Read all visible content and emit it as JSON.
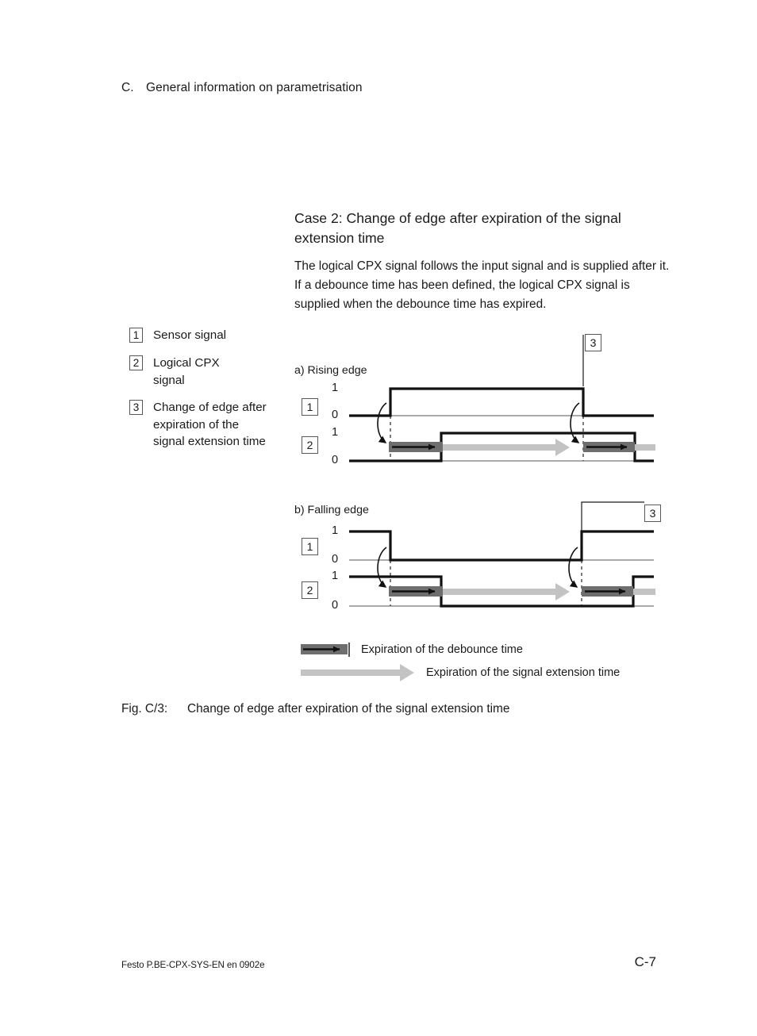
{
  "running_head": {
    "label": "C.",
    "title": "General information on parametrisation"
  },
  "case": {
    "heading": "Case 2: Change of edge after expiration of the signal extension time",
    "body": "The logical CPX signal follows the input signal and is supplied after it. If a debounce time has been defined, the logical CPX signal is supplied when the debounce time has expired."
  },
  "legend": {
    "items": [
      {
        "num": "1",
        "text": "Sensor signal"
      },
      {
        "num": "2",
        "text": "Logical CPX signal"
      },
      {
        "num": "3",
        "text": "Change of edge after expiration of the signal extension time"
      }
    ]
  },
  "diagrams": [
    {
      "title": "a) Rising edge",
      "callout": "3",
      "signals": [
        {
          "box": "1",
          "high_label": "1",
          "low_label": "0"
        },
        {
          "box": "2",
          "high_label": "1",
          "low_label": "0"
        }
      ]
    },
    {
      "title": "b) Falling edge",
      "callout": "3",
      "signals": [
        {
          "box": "1",
          "high_label": "1",
          "low_label": "0"
        },
        {
          "box": "2",
          "high_label": "1",
          "low_label": "0"
        }
      ]
    }
  ],
  "arrow_legend": [
    {
      "type": "debounce",
      "label": "Expiration of the debounce time",
      "color": "#6e6e6e"
    },
    {
      "type": "extension",
      "label": "Expiration of the signal extension time",
      "color": "#c3c3c3"
    }
  ],
  "figure_caption": {
    "number": "Fig. C/3:",
    "text": "Change of edge after expiration of the signal extension time"
  },
  "footer": {
    "left": "Festo P.BE-CPX-SYS-EN  en 0902e",
    "right": "C-7"
  },
  "colors": {
    "ink": "#1a1a1a",
    "box_border": "#58585a",
    "debounce_arrow": "#6e6e6e",
    "extension_arrow": "#c3c3c3",
    "axis_line": "#555555"
  }
}
